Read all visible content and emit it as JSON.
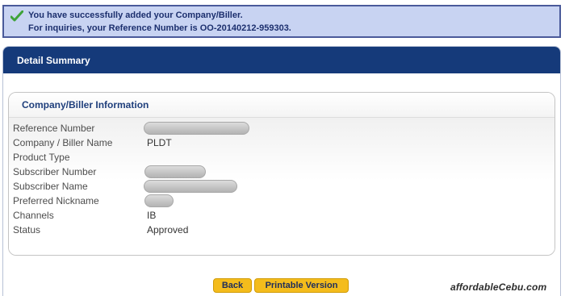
{
  "banner": {
    "line1": "You have successfully added your Company/Biller.",
    "line2": "For inquiries, your Reference Number is OO-20140212-959303."
  },
  "panel": {
    "title": "Detail Summary",
    "section_title": "Company/Biller Information"
  },
  "details": [
    {
      "label": "Reference Number",
      "value": ""
    },
    {
      "label": "Company / Biller Name",
      "value": "PLDT"
    },
    {
      "label": "Product Type",
      "value": ""
    },
    {
      "label": "Subscriber Number",
      "value": ""
    },
    {
      "label": "Subscriber Name",
      "value": ""
    },
    {
      "label": "Preferred Nickname",
      "value": ""
    },
    {
      "label": "Channels",
      "value": "IB"
    },
    {
      "label": "Status",
      "value": "Approved"
    }
  ],
  "buttons": {
    "back": "Back",
    "printable": "Printable Version"
  },
  "watermark": "affordableCebu.com",
  "colors": {
    "banner_bg": "#c8d3f2",
    "header_bg": "#153a7a",
    "button_bg": "#f4bc1c",
    "title_text": "#1f3f7c"
  }
}
